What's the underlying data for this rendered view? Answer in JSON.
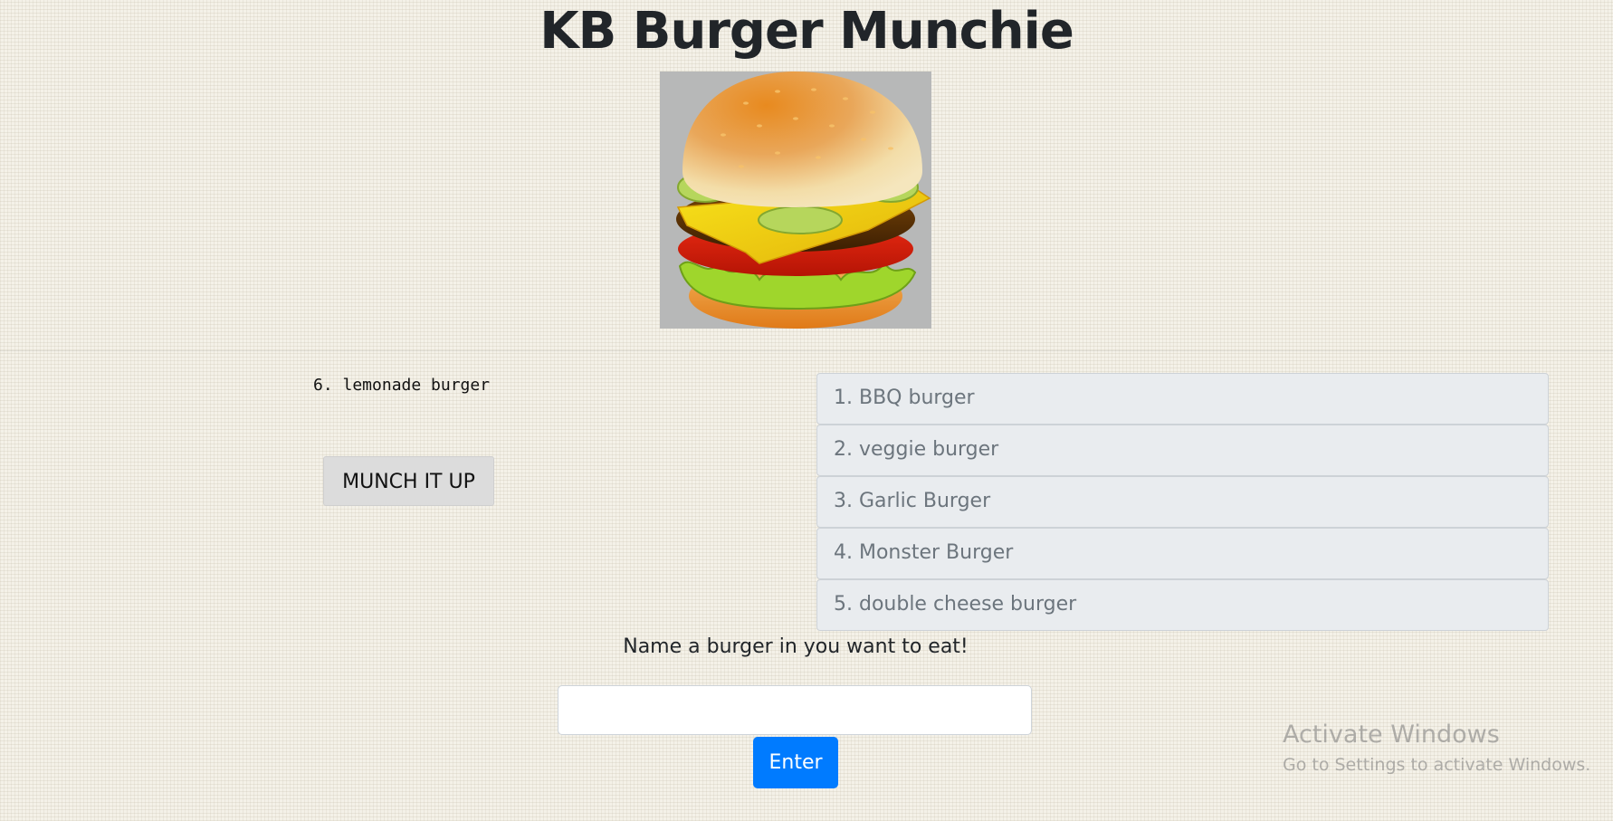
{
  "page": {
    "title": "KB Burger Munchie"
  },
  "hero": {
    "image_alt": "cheeseburger"
  },
  "devoured": {
    "items": [
      "6. lemonade burger"
    ]
  },
  "munch_button": {
    "label": "MUNCH IT UP"
  },
  "menu": {
    "items": [
      {
        "label": "1. BBQ burger"
      },
      {
        "label": "2. veggie burger"
      },
      {
        "label": "3. Garlic Burger"
      },
      {
        "label": "4. Monster Burger"
      },
      {
        "label": "5. double cheese burger"
      }
    ]
  },
  "form": {
    "prompt": "Name a burger in you want to eat!",
    "input_value": "",
    "submit_label": "Enter"
  },
  "watermark": {
    "title": "Activate Windows",
    "subtitle": "Go to Settings to activate Windows."
  },
  "colors": {
    "background": "#f4f1e8",
    "primary_button": "#007bff",
    "list_item_bg": "#e9ecef",
    "list_item_text": "#6c757d",
    "munch_button_bg": "#dcdcdc"
  }
}
